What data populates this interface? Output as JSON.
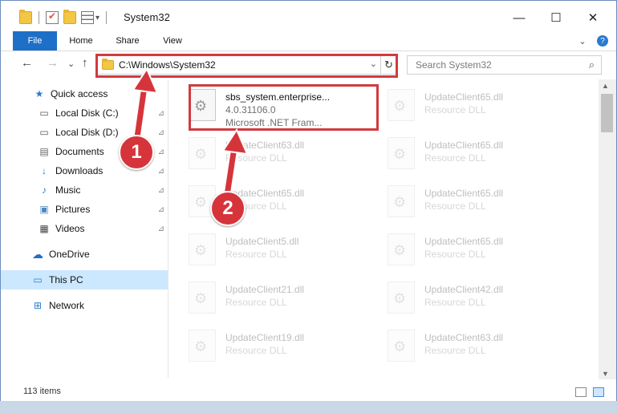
{
  "window": {
    "title": "System32",
    "controls": {
      "minimize": "—",
      "maximize": "☐",
      "close": "✕"
    }
  },
  "ribbon": {
    "tabs": [
      "File",
      "Home",
      "Share",
      "View"
    ],
    "collapse_glyph": "⌄",
    "help_glyph": "?"
  },
  "navigation": {
    "back": "←",
    "forward": "→",
    "recent": "⌄",
    "up": "↑",
    "address_path": "C:\\Windows\\System32",
    "refresh": "↻",
    "search_placeholder": "Search System32",
    "search_icon": "⌕"
  },
  "sidebar": {
    "items": [
      {
        "label": "Quick access",
        "icon": "star-icon",
        "glyph": "★",
        "pinned": false,
        "active": false
      },
      {
        "label": "Local Disk (C:)",
        "icon": "drive-icon",
        "glyph": "▭",
        "pinned": true,
        "active": false
      },
      {
        "label": "Local Disk (D:)",
        "icon": "drive-icon",
        "glyph": "▭",
        "pinned": true,
        "active": false
      },
      {
        "label": "Documents",
        "icon": "documents-icon",
        "glyph": "▤",
        "pinned": true,
        "active": false
      },
      {
        "label": "Downloads",
        "icon": "download-icon",
        "glyph": "↓",
        "pinned": true,
        "active": false
      },
      {
        "label": "Music",
        "icon": "music-icon",
        "glyph": "♪",
        "pinned": true,
        "active": false
      },
      {
        "label": "Pictures",
        "icon": "pictures-icon",
        "glyph": "▣",
        "pinned": true,
        "active": false
      },
      {
        "label": "Videos",
        "icon": "videos-icon",
        "glyph": "▦",
        "pinned": true,
        "active": false
      },
      {
        "label": "OneDrive",
        "icon": "cloud-icon",
        "glyph": "☁",
        "pinned": false,
        "active": false
      },
      {
        "label": "This PC",
        "icon": "computer-icon",
        "glyph": "▭",
        "pinned": false,
        "active": true
      },
      {
        "label": "Network",
        "icon": "network-icon",
        "glyph": "⊞",
        "pinned": false,
        "active": false
      }
    ],
    "pin_glyph": "📌"
  },
  "files": {
    "highlighted": {
      "name": "sbs_system.enterprise...",
      "version": "4.0.31106.0",
      "company": "Microsoft .NET Fram..."
    },
    "items": [
      {
        "name": "UpdateClient65.dll",
        "type": "Resource DLL"
      },
      {
        "name": "UpdateClient63.dll",
        "type": "Resource DLL"
      },
      {
        "name": "UpdateClient65.dll",
        "type": "Resource DLL"
      },
      {
        "name": "UpdateClient65.dll",
        "type": "Resource DLL"
      },
      {
        "name": "UpdateClient65.dll",
        "type": "Resource DLL"
      },
      {
        "name": "UpdateClient5.dll",
        "type": "Resource DLL"
      },
      {
        "name": "UpdateClient65.dll",
        "type": "Resource DLL"
      },
      {
        "name": "UpdateClient21.dll",
        "type": "Resource DLL"
      },
      {
        "name": "UpdateClient42.dll",
        "type": "Resource DLL"
      },
      {
        "name": "UpdateClient19.dll",
        "type": "Resource DLL"
      },
      {
        "name": "UpdateClient63.dll",
        "type": "Resource DLL"
      }
    ]
  },
  "status": {
    "item_count": "113 items"
  },
  "callouts": {
    "one": "1",
    "two": "2"
  },
  "colors": {
    "highlight_red": "#d23a3f",
    "file_tab_blue": "#1e6fc8",
    "active_nav": "#cce8ff"
  }
}
